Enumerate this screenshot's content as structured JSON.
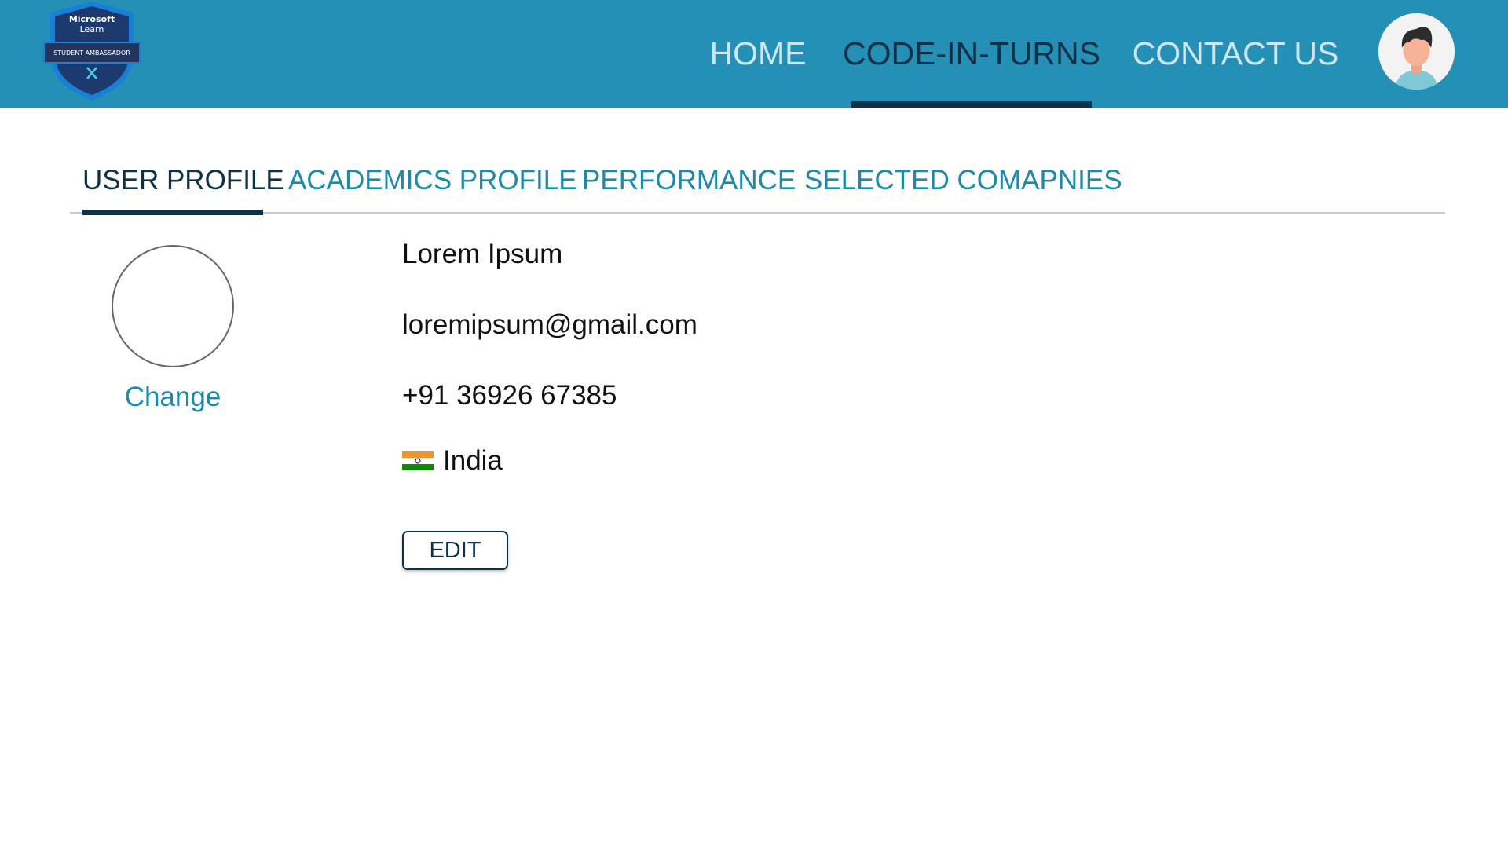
{
  "header": {
    "logo": {
      "line1": "Microsoft",
      "line2": "Learn",
      "ribbon": "STUDENT AMBASSADOR"
    },
    "nav": [
      {
        "label": "HOME",
        "active": false
      },
      {
        "label": "CODE-IN-TURNS",
        "active": true
      },
      {
        "label": "CONTACT US",
        "active": false
      }
    ],
    "avatar_icon": "user-avatar-icon",
    "colors": {
      "bar": "#2590b6",
      "active": "#0e3148",
      "inactive": "#cfe6f0"
    }
  },
  "tabs": [
    {
      "label": "USER PROFILE",
      "active": true
    },
    {
      "label": "ACADEMICS PROFILE",
      "active": false
    },
    {
      "label": "PERFORMANCE",
      "active": false
    },
    {
      "label": "SELECTED COMAPNIES",
      "active": false
    }
  ],
  "profile": {
    "change_label": "Change",
    "name": "Lorem Ipsum",
    "email": "loremipsum@gmail.com",
    "phone": "+91 36926 67385",
    "country": "India",
    "country_flag_icon": "india-flag-icon",
    "edit_label": "EDIT"
  }
}
